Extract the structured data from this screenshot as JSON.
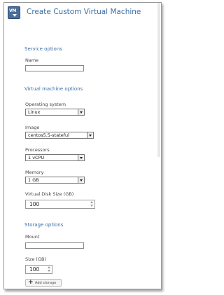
{
  "window": {
    "title": "Create Custom Virtual Machine",
    "logo_text": "VM"
  },
  "service_options": {
    "heading": "Service options",
    "name_label": "Name",
    "name_value": ""
  },
  "vm_options": {
    "heading": "Virtual machine options",
    "os_label": "Operating system",
    "os_value": "Linux",
    "image_label": "Image",
    "image_value": "centos5.5-stateful",
    "processors_label": "Processors",
    "processors_value": "1 vCPU",
    "memory_label": "Memory",
    "memory_value": "1 GB",
    "disk_label": "Virtual Disk Size (GB)",
    "disk_value": "100"
  },
  "storage_options": {
    "heading": "Storage options",
    "mount_label": "Mount",
    "mount_value": "",
    "size_label": "Size (GB)",
    "size_value": "100",
    "add_label": "Add storage"
  },
  "icons": [
    "vm-logo-icon",
    "dropdown-arrow-icon",
    "spinner-up-icon",
    "spinner-down-icon",
    "plus-icon"
  ]
}
